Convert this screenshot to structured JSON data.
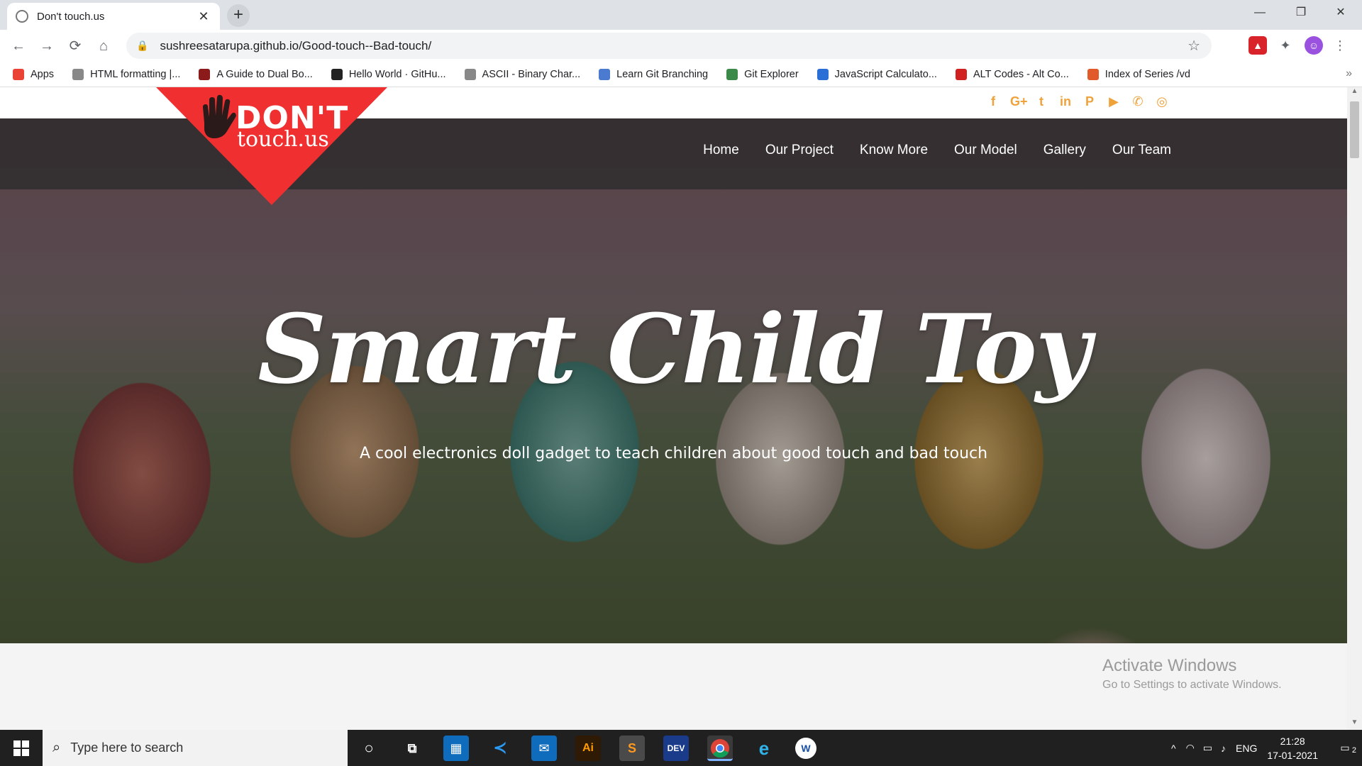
{
  "browser": {
    "tab_title": "Don't touch.us",
    "tab_close": "✕",
    "new_tab": "+",
    "url": "sushreesatarupa.github.io/Good-touch--Bad-touch/",
    "window_controls": [
      "—",
      "❐",
      "✕"
    ]
  },
  "nav_buttons": [
    "←",
    "→",
    "⟳",
    "⌂"
  ],
  "bookmarks": [
    {
      "label": "Apps",
      "icon": "apps-icon",
      "color": "#ea4335"
    },
    {
      "label": "HTML formatting |...",
      "icon": "globe-icon",
      "color": "#888888"
    },
    {
      "label": "A Guide to Dual Bo...",
      "icon": "bookmark-icon",
      "color": "#8b1a1a"
    },
    {
      "label": "Hello World · GitHu...",
      "icon": "github-icon",
      "color": "#222222"
    },
    {
      "label": "ASCII - Binary Char...",
      "icon": "globe-icon",
      "color": "#888888"
    },
    {
      "label": "Learn Git Branching",
      "icon": "git-branch-icon",
      "color": "#4a7bd0"
    },
    {
      "label": "Git Explorer",
      "icon": "git-icon",
      "color": "#3b8a4a"
    },
    {
      "label": "JavaScript Calculato...",
      "icon": "e-icon",
      "color": "#2a6fd6"
    },
    {
      "label": "ALT Codes - Alt Co...",
      "icon": "alt-icon",
      "color": "#d02020"
    },
    {
      "label": "Index of Series /vd",
      "icon": "index-icon",
      "color": "#e05a2a"
    }
  ],
  "site": {
    "logo_line1": "DON'T",
    "logo_line2": "touch.us",
    "social": [
      "f",
      "G+",
      "t",
      "in",
      "P",
      "▶",
      "✆",
      "◎"
    ],
    "nav": [
      "Home",
      "Our Project",
      "Know More",
      "Our Model",
      "Gallery",
      "Our Team"
    ],
    "hero_title": "Smart Child Toy",
    "hero_subtitle": "A cool electronics doll gadget to teach children about good touch and bad touch",
    "brand_red": "#f03030",
    "accent_orange": "#f0a23a"
  },
  "windows": {
    "activate_title": "Activate Windows",
    "activate_sub": "Go to Settings to activate Windows.",
    "search_placeholder": "Type here to search",
    "language": "ENG",
    "time": "21:28",
    "date": "17-01-2021",
    "notifications": "2"
  }
}
